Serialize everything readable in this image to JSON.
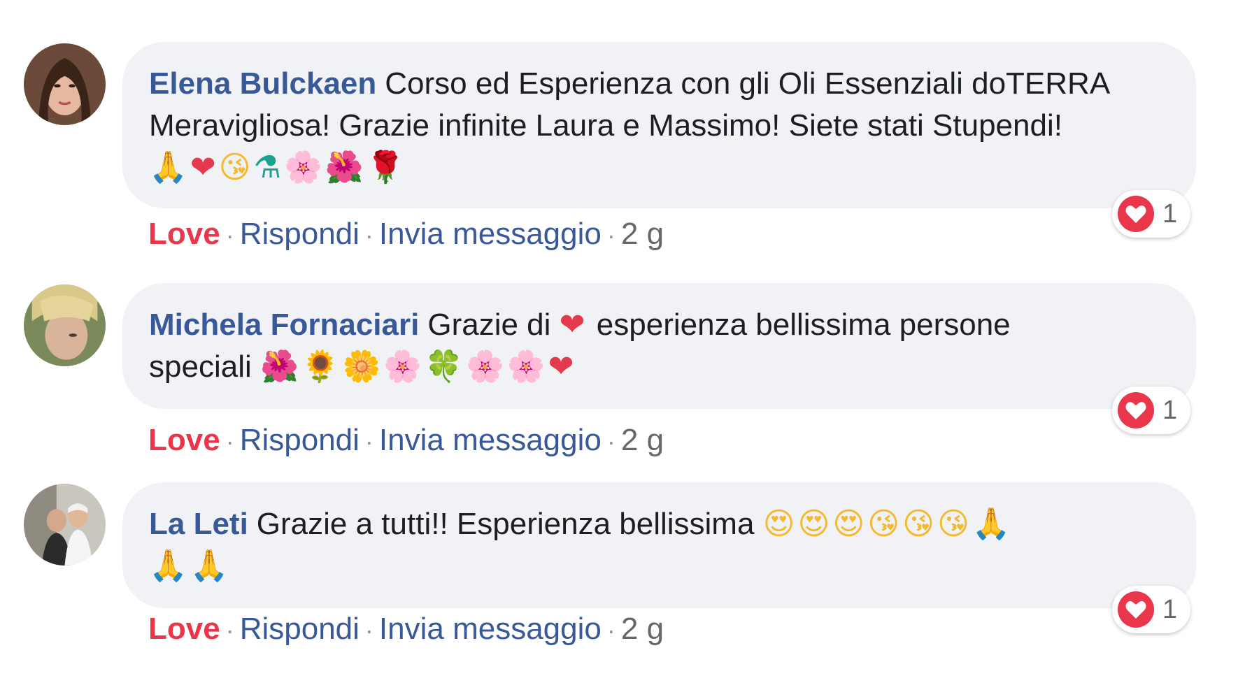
{
  "comments": [
    {
      "author": "Elena Bulckaen",
      "text_line1": "Corso ed Esperienza con gli Oli Essenziali doTERRA",
      "text_line2": "Meravigliosa! Grazie infinite Laura e Massimo! Siete stati Stupendi!",
      "emoji_line": [
        "🙏",
        "❤",
        "😘",
        "⚗",
        "🌸",
        "🌺",
        "🌹"
      ],
      "actions": {
        "love": "Love",
        "reply": "Rispondi",
        "message": "Invia messaggio",
        "time": "2 g"
      },
      "reaction_count": "1"
    },
    {
      "author": "Michela Fornaciari",
      "text_line1": "Grazie di",
      "text_line1_after": "esperienza bellissima persone",
      "text_line2": "speciali",
      "emoji_after_line1": "❤",
      "emoji_line": [
        "🌺",
        "🌻",
        "🌼",
        "🌸",
        "🍀",
        "🌸",
        "🌸",
        "❤"
      ],
      "actions": {
        "love": "Love",
        "reply": "Rispondi",
        "message": "Invia messaggio",
        "time": "2 g"
      },
      "reaction_count": "1"
    },
    {
      "author": "La Leti",
      "text_line1": "Grazie a tutti!! Esperienza bellissima",
      "emoji_line1": [
        "😍",
        "😍",
        "😍",
        "😘",
        "😘",
        "😘",
        "🙏"
      ],
      "emoji_line2": [
        "🙏",
        "🙏"
      ],
      "actions": {
        "love": "Love",
        "reply": "Rispondi",
        "message": "Invia messaggio",
        "time": "2 g"
      },
      "reaction_count": "1"
    }
  ],
  "separator": "·",
  "colors": {
    "author": "#385898",
    "love": "#e9364b",
    "bubble": "#f0f2f5",
    "meta": "#65676b"
  },
  "icons": [
    "heart-reaction-icon",
    "avatar"
  ]
}
